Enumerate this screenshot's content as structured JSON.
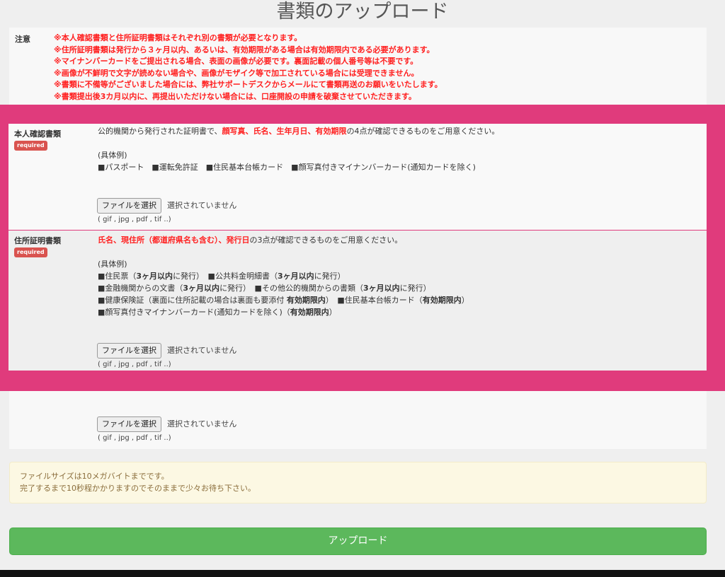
{
  "title": "書類のアップロード",
  "notice": {
    "label": "注意",
    "lines": [
      "※本人確認書類と住所証明書類はそれぞれ別の書類が必要となります。",
      "※住所証明書類は発行から３ヶ月以内、あるいは、有効期限がある場合は有効期限内である必要があります。",
      "※マイナンバーカードをご提出される場合、表面の画像が必要です。裏面記載の個人番号等は不要です。",
      "※画像が不鮮明で文字が読めない場合や、画像がモザイク等で加工されている場合には受理できません。",
      "※書類に不備等がございました場合には、弊社サポートデスクからメールにて書類再送のお願いをいたします。",
      "※書類提出後3カ月以内に、再提出いただけない場合には、口座開設の申請を破棄させていただきます。"
    ]
  },
  "identity": {
    "label": "本人確認書類",
    "badge": "required",
    "desc_prefix": "公的機関から発行された証明書で、",
    "desc_red": "顔写真、氏名、生年月日、有効期限",
    "desc_suffix": "の4点が確認できるものをご用意ください。",
    "example_head": "(具体例)",
    "examples": "■パスポート　■運転免許証　■住民基本台帳カード　■顔写真付きマイナンバーカード(通知カードを除く)",
    "file_button": "ファイルを選択",
    "file_status": "選択されていません",
    "file_hint": "( gif , jpg , pdf , tif ..)"
  },
  "address": {
    "label": "住所証明書類",
    "badge": "required",
    "desc_red": "氏名、現住所（都道府県名も含む）、発行日",
    "desc_suffix": "の3点が確認できるものをご用意ください。",
    "example_head": "(具体例)",
    "ex1a": "■住民票（",
    "ex1b": "3ヶ月以内",
    "ex1c": "に発行）　■公共料金明細書（",
    "ex1d": "3ヶ月以内",
    "ex1e": "に発行）",
    "ex2a": "■金融機関からの文書（",
    "ex2b": "3ヶ月以内",
    "ex2c": "に発行）　■その他公的機関からの書類（",
    "ex2d": "3ヶ月以内",
    "ex2e": "に発行）",
    "ex3a": "■健康保険証（裏面に住所記載の場合は裏面も要添付 ",
    "ex3b": "有効期限内",
    "ex3c": "）　■住民基本台帳カード（",
    "ex3d": "有効期限内",
    "ex3e": "）",
    "ex4a": "■顔写真付きマイナンバーカード(通知カードを除く)（",
    "ex4b": "有効期限内",
    "ex4c": "）",
    "file_button": "ファイルを選択",
    "file_status": "選択されていません",
    "file_hint": "( gif , jpg , pdf , tif ..)"
  },
  "extra": {
    "file_button": "ファイルを選択",
    "file_status": "選択されていません",
    "file_hint": "( gif , jpg , pdf , tif ..)"
  },
  "warning": {
    "line1": "ファイルサイズは10メガバイトまでです。",
    "line2": "完了するまで10秒程かかりますのでそのままで少々お待ち下さい。"
  },
  "upload_button": "アップロード",
  "colors": {
    "highlight": "#e03b7c",
    "required_badge": "#d9534f",
    "notice_red": "#ff2020",
    "upload_green": "#5cb85c"
  }
}
